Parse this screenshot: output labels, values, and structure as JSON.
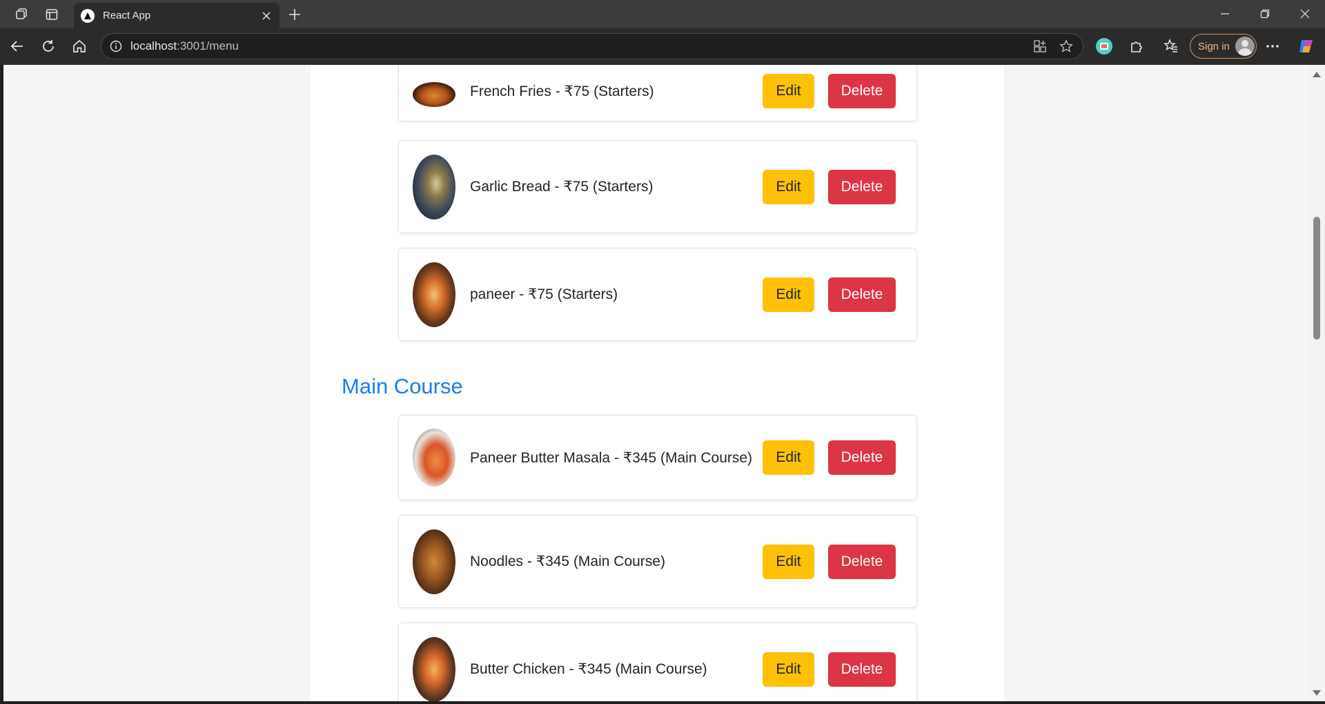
{
  "browser": {
    "tab_title": "React App",
    "url_host": "localhost",
    "url_path": ":3001/menu",
    "signin_label": "Sign in"
  },
  "sections": [
    {
      "items": [
        {
          "text": "French Fries - ₹75 (Starters)",
          "edit": "Edit",
          "delete": "Delete",
          "image_icon": "food-photo-icon"
        },
        {
          "text": "Garlic Bread - ₹75 (Starters)",
          "edit": "Edit",
          "delete": "Delete",
          "image_icon": "food-photo-icon"
        },
        {
          "text": "paneer - ₹75 (Starters)",
          "edit": "Edit",
          "delete": "Delete",
          "image_icon": "food-photo-icon"
        }
      ]
    },
    {
      "title": "Main Course",
      "items": [
        {
          "text": "Paneer Butter Masala - ₹345 (Main Course)",
          "edit": "Edit",
          "delete": "Delete",
          "image_icon": "food-photo-icon"
        },
        {
          "text": "Noodles - ₹345 (Main Course)",
          "edit": "Edit",
          "delete": "Delete",
          "image_icon": "food-photo-icon"
        },
        {
          "text": "Butter Chicken - ₹345 (Main Course)",
          "edit": "Edit",
          "delete": "Delete",
          "image_icon": "food-photo-icon"
        }
      ]
    }
  ],
  "colors": {
    "section_title": "#1a7cf0",
    "edit_button": "#ffc107",
    "delete_button": "#dc3545",
    "page_background": "#f4f5f7"
  }
}
